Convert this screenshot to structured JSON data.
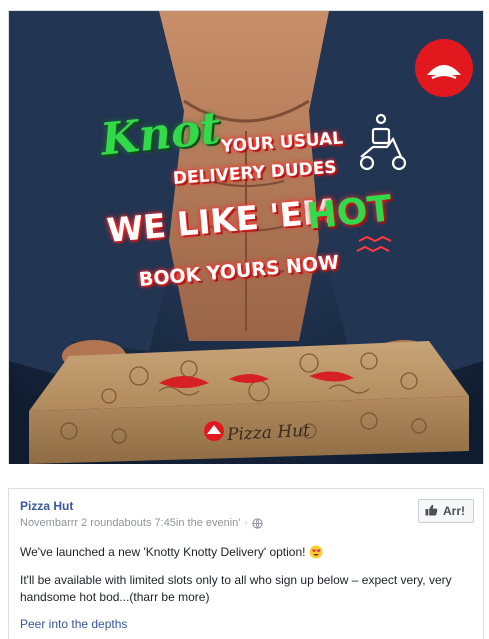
{
  "ad": {
    "headline_knot": "Knot",
    "headline_line1": "YOUR USUAL",
    "headline_line2": "DELIVERY DUDES",
    "headline_like": "WE LIKE 'EM",
    "headline_hot": "HOT",
    "headline_book": "BOOK YOURS NOW",
    "box_brand": "Pizza Hut",
    "icons": [
      "pizza-hut-logo",
      "delivery-scooter-icon"
    ],
    "colors": {
      "accent_red": "#e1191f",
      "accent_green": "#32d94a",
      "background": "#15253d"
    }
  },
  "post": {
    "author": "Pizza Hut",
    "timestamp": "Novembarrr 2 roundabouts 7:45in the evenin'",
    "separator": "·",
    "audience_icon": "globe-icon",
    "like_label": "Arr!",
    "text_line1": "We've launched a new 'Knotty Knotty Delivery' option!",
    "text_line2": "It'll be available with limited slots only to all who sign up below – expect very, very handsome hot bod...(tharr be more)",
    "see_more": "Peer into the depths",
    "colors": {
      "link": "#365899",
      "meta": "#90949c",
      "text": "#1d2129"
    }
  }
}
